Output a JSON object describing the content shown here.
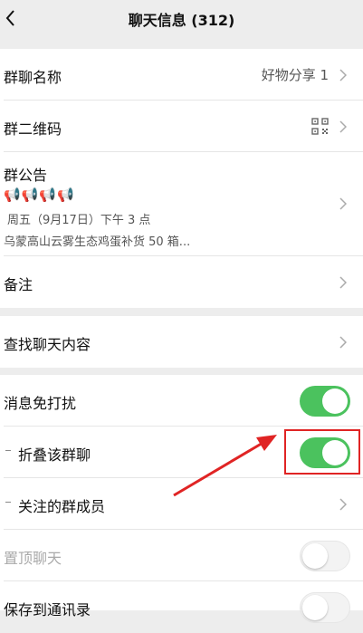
{
  "header": {
    "title": "聊天信息 (312)"
  },
  "group1": {
    "name_label": "群聊名称",
    "name_value": "好物分享 1",
    "qr_label": "群二维码",
    "notice": {
      "label": "群公告",
      "icons": "📢📢📢📢",
      "line1": "周五（9月17日）下午 3 点",
      "line2": "乌蒙高山云雾生态鸡蛋补货 50 箱..."
    },
    "remark_label": "备注"
  },
  "group2": {
    "search_label": "查找聊天内容"
  },
  "group3": {
    "mute_label": "消息免打扰",
    "fold_label": "折叠该群聊",
    "follow_label": "关注的群成员",
    "pin_label": "置顶聊天",
    "save_label": "保存到通讯录"
  },
  "colors": {
    "toggle_on": "#4bc25e",
    "highlight": "#e02424",
    "arrow": "#e02424"
  },
  "toggles": {
    "mute": true,
    "fold": true,
    "pin": false,
    "save": false
  }
}
